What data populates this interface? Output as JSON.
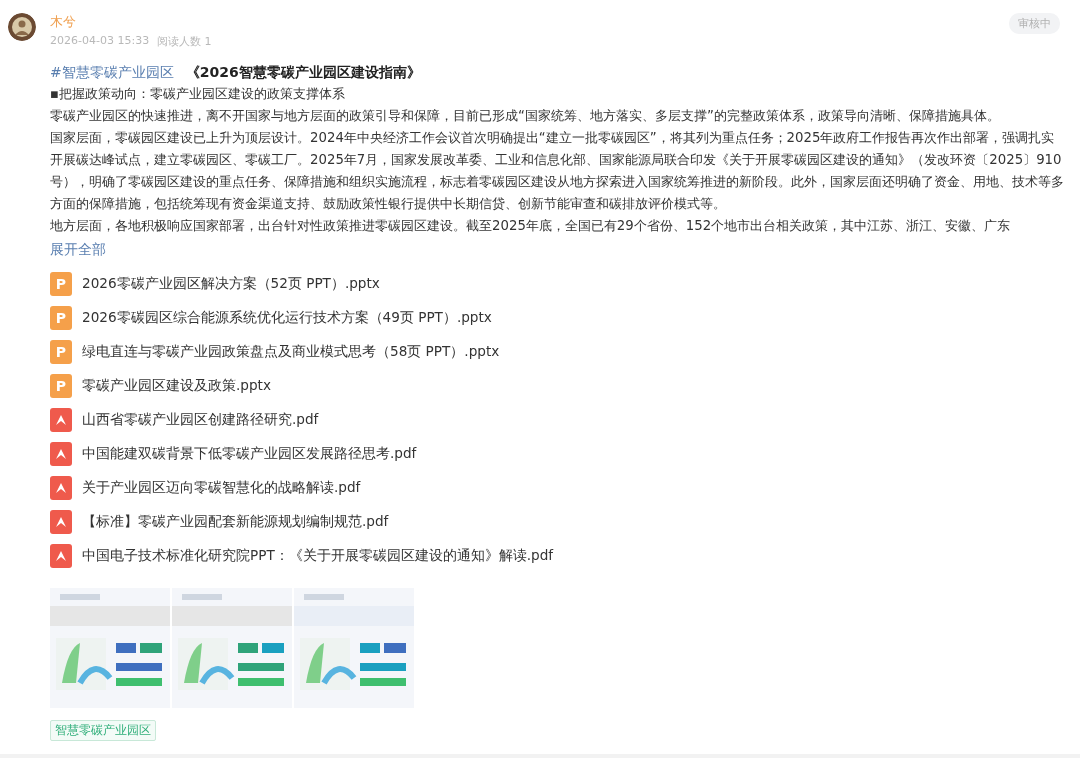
{
  "author": {
    "name": "木兮",
    "time": "2026-04-03 15:33",
    "reads": "阅读人数 1"
  },
  "status": "审核中",
  "post": {
    "topic": "#智慧零碳产业园区",
    "title": "《2026智慧零碳产业园区建设指南》",
    "paragraphs": [
      "▪把握政策动向：零碳产业园区建设的政策支撑体系",
      "零碳产业园区的快速推进，离不开国家与地方层面的政策引导和保障，目前已形成“国家统筹、地方落实、多层支撑”的完整政策体系，政策导向清晰、保障措施具体。",
      "国家层面，零碳园区建设已上升为顶层设计。2024年中央经济工作会议首次明确提出“建立一批零碳园区”，将其列为重点任务；2025年政府工作报告再次作出部署，强调扎实开展碳达峰试点，建立零碳园区、零碳工厂。2025年7月，国家发展改革委、工业和信息化部、国家能源局联合印发《关于开展零碳园区建设的通知》（发改环资〔2025〕910号），明确了零碳园区建设的重点任务、保障措施和组织实施流程，标志着零碳园区建设从地方探索进入国家统筹推进的新阶段。此外，国家层面还明确了资金、用地、技术等多方面的保障措施，包括统筹现有资金渠道支持、鼓励政策性银行提供中长期信贷、创新节能审查和碳排放评价模式等。",
      "地方层面，各地积极响应国家部署，出台针对性政策推进零碳园区建设。截至2025年底，全国已有29个省份、152个地市出台相关政策，其中江苏、浙江、安徽、广东"
    ],
    "expand": "展开全部"
  },
  "files": [
    {
      "kind": "pptx",
      "badge": "P",
      "name": "2026零碳产业园区解决方案（52页 PPT）.pptx"
    },
    {
      "kind": "pptx",
      "badge": "P",
      "name": "2026零碳园区综合能源系统优化运行技术方案（49页 PPT）.pptx"
    },
    {
      "kind": "pptx",
      "badge": "P",
      "name": "绿电直连与零碳产业园政策盘点及商业模式思考（58页 PPT）.pptx"
    },
    {
      "kind": "pptx",
      "badge": "P",
      "name": "零碳产业园区建设及政策.pptx"
    },
    {
      "kind": "pdf",
      "name": "山西省零碳产业园区创建路径研究.pdf"
    },
    {
      "kind": "pdf",
      "name": "中国能建双碳背景下低零碳产业园区发展路径思考.pdf"
    },
    {
      "kind": "pdf",
      "name": "关于产业园区迈向零碳智慧化的战略解读.pdf"
    },
    {
      "kind": "pdf",
      "name": "【标准】零碳产业园配套新能源规划编制规范.pdf"
    },
    {
      "kind": "pdf",
      "name": "中国电子技术标准化研究院PPT：《关于开展零碳园区建设的通知》解读.pdf"
    }
  ],
  "tags": [
    "智慧零碳产业园区"
  ]
}
